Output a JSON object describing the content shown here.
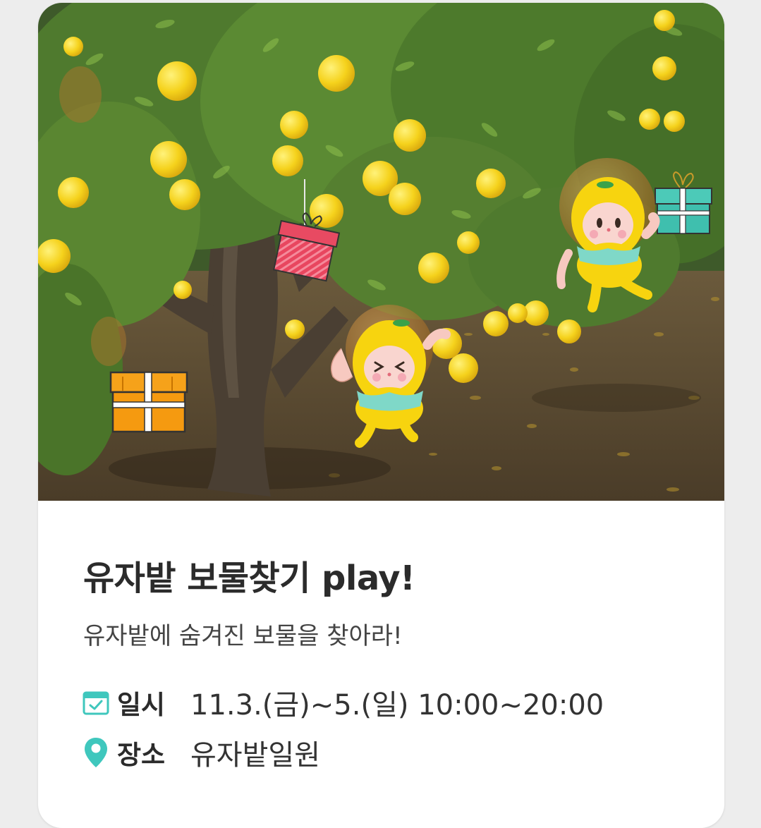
{
  "event": {
    "title": "유자밭 보물찾기 play!",
    "subtitle": "유자밭에 숨겨진 보물을 찾아라!",
    "date_label": "일시",
    "date_value": "11.3.(금)~5.(일) 10:00~20:00",
    "place_label": "장소",
    "place_value": "유자밭일원"
  },
  "icons": {
    "date": "calendar-check-icon",
    "place": "map-pin-icon"
  },
  "colors": {
    "accent": "#3fc7bd",
    "yuzu_yellow": "#f6cf1f",
    "title_text": "#2b2b2b"
  }
}
